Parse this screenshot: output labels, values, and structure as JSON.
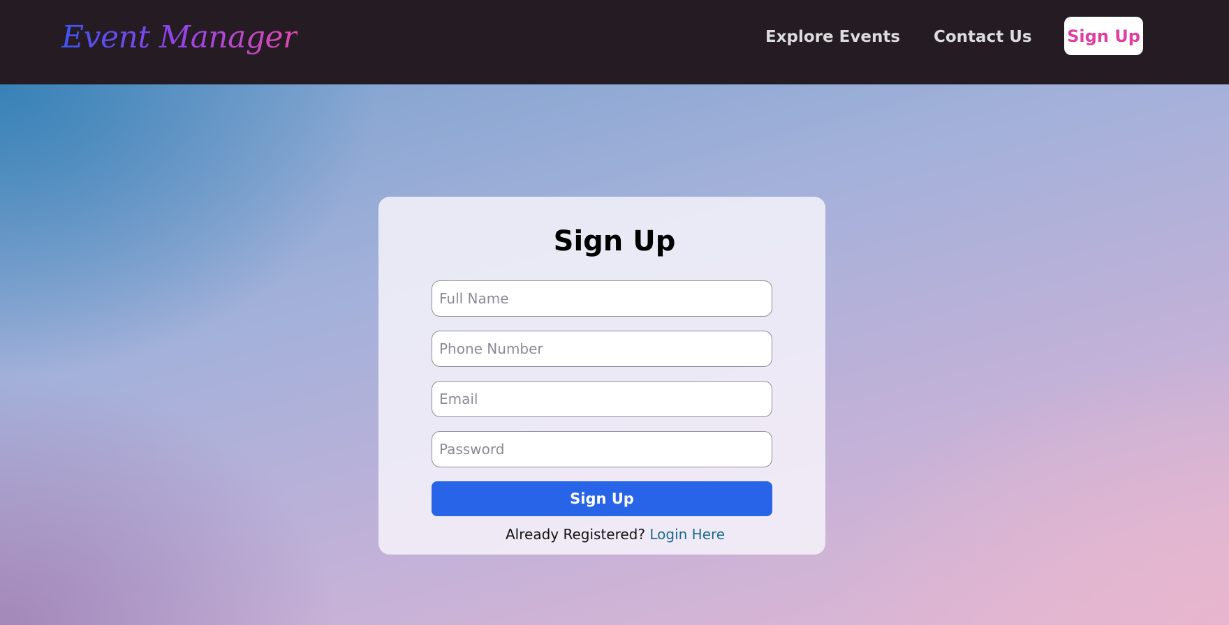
{
  "header": {
    "brand": "Event Manager",
    "nav": {
      "explore": "Explore Events",
      "contact": "Contact Us",
      "signup": "Sign Up"
    }
  },
  "form": {
    "title": "Sign Up",
    "fields": {
      "full_name": {
        "placeholder": "Full Name",
        "value": ""
      },
      "phone": {
        "placeholder": "Phone Number",
        "value": ""
      },
      "email": {
        "placeholder": "Email",
        "value": ""
      },
      "password": {
        "placeholder": "Password",
        "value": ""
      }
    },
    "submit_label": "Sign Up",
    "login_prompt": "Already Registered?",
    "login_link": "Login Here"
  },
  "colors": {
    "navbar": "#251b23",
    "accent_pink": "#e03fa0",
    "primary_button": "#2764e8",
    "link": "#1a6a8e"
  }
}
